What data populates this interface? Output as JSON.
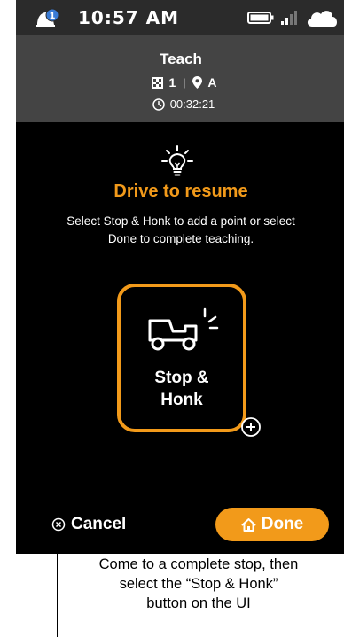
{
  "status_bar": {
    "time": "10:57 AM",
    "notification_count": "1",
    "icons": [
      "notification-icon",
      "battery-icon",
      "signal-icon",
      "cloud-icon"
    ]
  },
  "header": {
    "title": "Teach",
    "route_number": "1",
    "separator": "|",
    "location": "A",
    "timer": "00:32:21"
  },
  "main": {
    "icon": "lightbulb-icon",
    "title": "Drive to resume",
    "description": "Select Stop & Honk to add a point or select Done to complete teaching."
  },
  "stop_honk_button": {
    "label_line1": "Stop &",
    "label_line2": "Honk",
    "icon": "truck-honk-icon",
    "badge_icon": "add-icon"
  },
  "footer": {
    "cancel_label": "Cancel",
    "done_label": "Done"
  },
  "annotation": {
    "line1": "Come to a complete stop, then",
    "line2": "select the “Stop & Honk”",
    "line3": "button on the UI"
  },
  "colors": {
    "accent": "#f29a1a",
    "background": "#000000",
    "header": "#444444",
    "status_bar": "#2b2b2b",
    "notification_badge": "#3a7bd5"
  }
}
